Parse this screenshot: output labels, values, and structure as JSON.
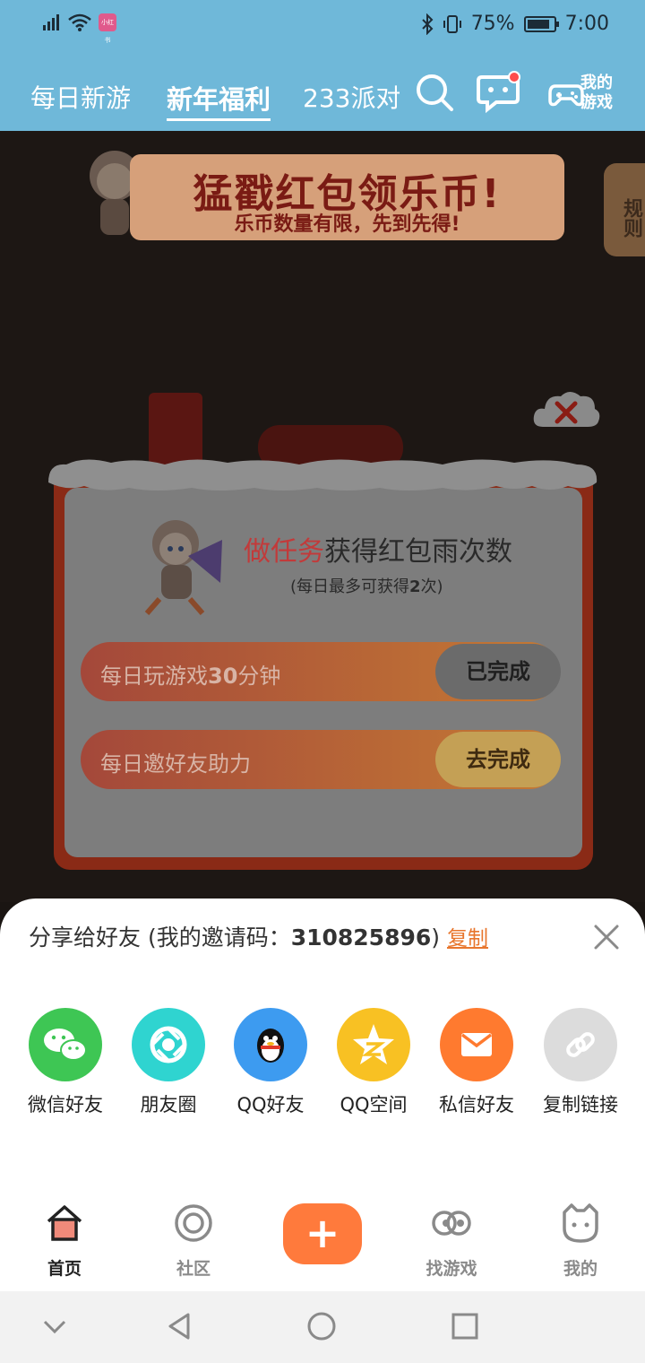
{
  "status_bar": {
    "battery": "75%",
    "time": "7:00",
    "app_badge": "小红书"
  },
  "top_nav": {
    "tabs": [
      {
        "label": "每日新游"
      },
      {
        "label": "新年福利"
      },
      {
        "label": "233派对"
      }
    ],
    "my_games_label": "我的游戏"
  },
  "banner": {
    "title": "猛戳红包领乐币!",
    "subtitle": "乐币数量有限，先到先得!",
    "rules_label": "规则"
  },
  "modal": {
    "title_highlight": "做任务",
    "title_rest": "获得红包雨次数",
    "note_prefix": "(每日最多可获得",
    "note_count": "2",
    "note_suffix": "次)",
    "tasks": [
      {
        "label_prefix": "每日玩游戏",
        "label_bold": "30",
        "label_suffix": "分钟",
        "button": "已完成"
      },
      {
        "label_prefix": "每日邀好友助力",
        "label_bold": "",
        "label_suffix": "",
        "button": "去完成"
      }
    ]
  },
  "share_sheet": {
    "title": "分享给好友 (我的邀请码：",
    "invite_code": "310825896",
    "title_close": ")",
    "copy_label": "复制",
    "items": [
      {
        "label": "微信好友",
        "icon": "wechat-icon",
        "color": "#3ec654"
      },
      {
        "label": "朋友圈",
        "icon": "moments-icon",
        "color": "#2fd4d0"
      },
      {
        "label": "QQ好友",
        "icon": "qq-icon",
        "color": "#3d9bf0"
      },
      {
        "label": "QQ空间",
        "icon": "qzone-icon",
        "color": "#f8c123"
      },
      {
        "label": "私信好友",
        "icon": "mail-icon",
        "color": "#ff7a2f"
      },
      {
        "label": "复制链接",
        "icon": "link-icon",
        "color": "#dcdcdc"
      }
    ]
  },
  "bottom_tabs": [
    {
      "label": "首页",
      "icon": "home-icon"
    },
    {
      "label": "社区",
      "icon": "community-icon"
    },
    {
      "label": "+",
      "icon": "plus-icon"
    },
    {
      "label": "找游戏",
      "icon": "find-game-icon"
    },
    {
      "label": "我的",
      "icon": "profile-icon"
    }
  ]
}
